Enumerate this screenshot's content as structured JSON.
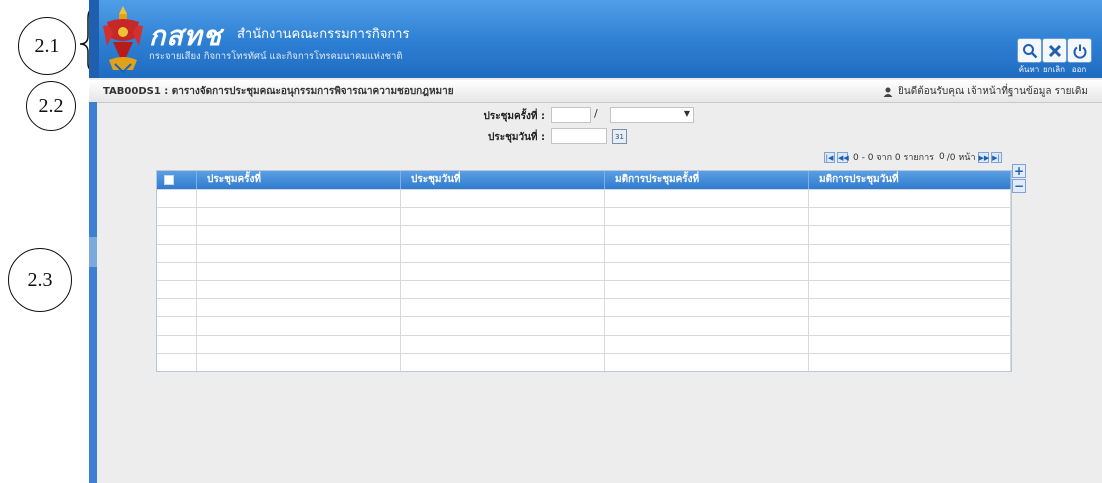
{
  "annotations": [
    "2.1",
    "2.2",
    "2.3"
  ],
  "header": {
    "brand": "กสทช",
    "org_title": "สำนักงานคณะกรรมการกิจการ",
    "org_subtitle": "กระจายเสียง กิจการโทรทัศน์ และกิจการโทรคมนาคมแห่งชาติ",
    "buttons": [
      {
        "icon": "search-icon",
        "label": "ค้นหา"
      },
      {
        "icon": "close-icon",
        "label": "ยกเลิก"
      },
      {
        "icon": "power-icon",
        "label": "ออก"
      }
    ]
  },
  "breadcrumb": {
    "screen_code_title": "TAB00DS1 : ตารางจัดการประชุมคณะอนุกรรมการพิจารณาความชอบกฎหมาย",
    "welcome": "ยินดีต้อนรับคุณ เจ้าหน้าที่ฐานข้อมูล รายเดิม"
  },
  "form": {
    "meeting_no_label": "ประชุมครั้งที่ :",
    "meeting_no_value": "",
    "slash": "/",
    "meeting_year_value": "",
    "meeting_date_label": "ประชุมวันที่ :",
    "meeting_date_value": "",
    "calendar_label": "31"
  },
  "pager": {
    "range": "0 - 0 จาก 0 รายการ",
    "page_value": "0",
    "page_total": "/0 หน้า"
  },
  "grid": {
    "columns": [
      "ประชุมครั้งที่",
      "ประชุมวันที่",
      "มติการประชุมครั้งที่",
      "มติการประชุมวันที่"
    ],
    "rows": [
      [
        "",
        "",
        "",
        ""
      ],
      [
        "",
        "",
        "",
        ""
      ],
      [
        "",
        "",
        "",
        ""
      ],
      [
        "",
        "",
        "",
        ""
      ],
      [
        "",
        "",
        "",
        ""
      ],
      [
        "",
        "",
        "",
        ""
      ],
      [
        "",
        "",
        "",
        ""
      ],
      [
        "",
        "",
        "",
        ""
      ],
      [
        "",
        "",
        "",
        ""
      ],
      [
        "",
        "",
        "",
        ""
      ]
    ]
  },
  "colors": {
    "header_blue": "#2d7fd3",
    "grid_header": "#3b86d6",
    "background": "#ededed"
  }
}
